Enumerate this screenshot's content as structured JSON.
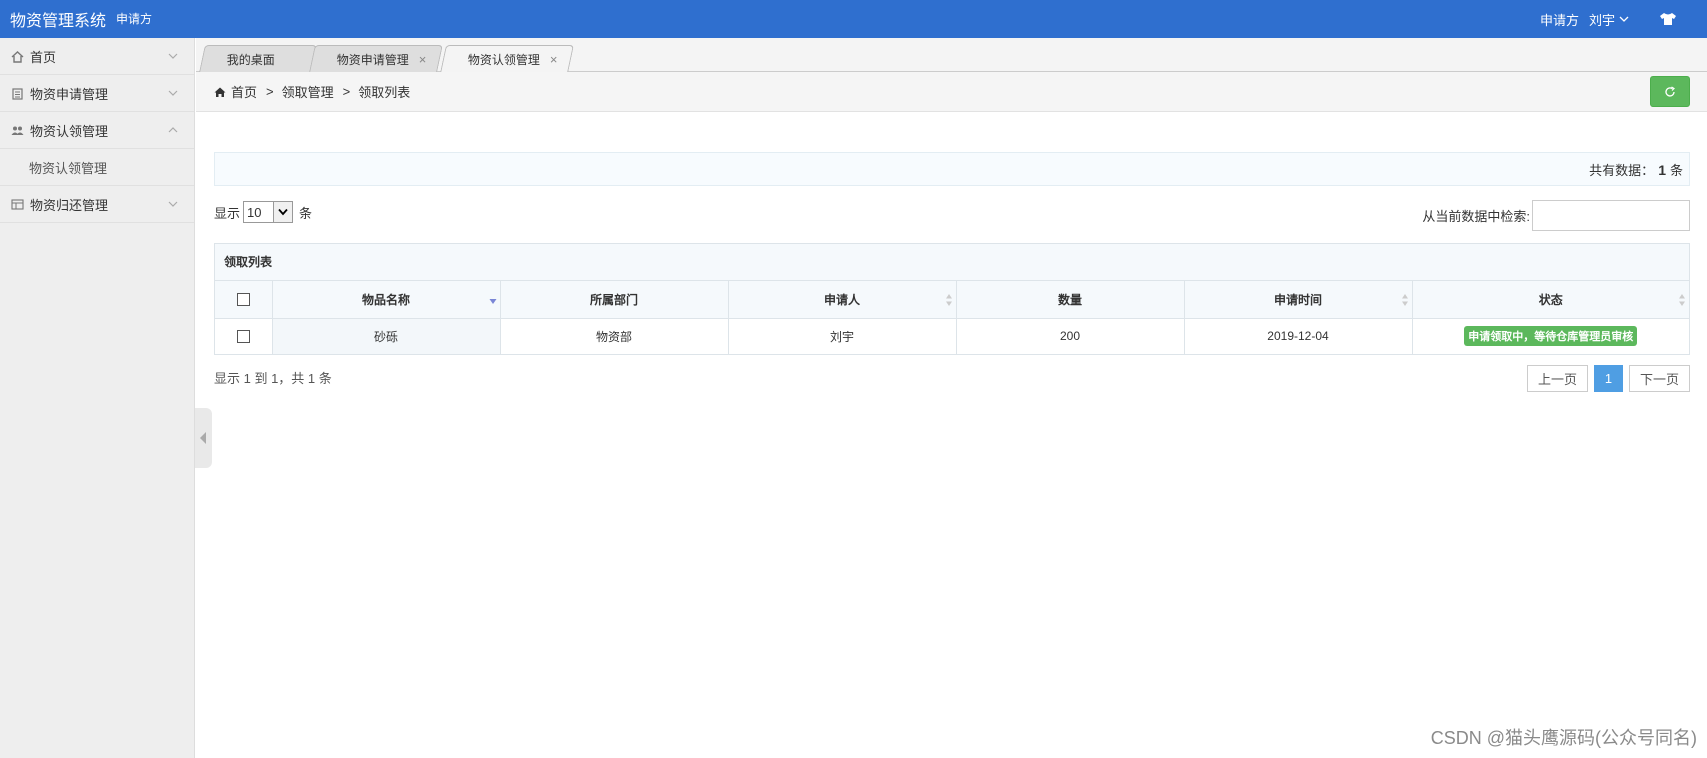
{
  "header": {
    "title": "物资管理系统",
    "role": "申请方",
    "right_role": "申请方",
    "user": "刘宇",
    "colors": {
      "bar": "#2f6fcf"
    }
  },
  "sidebar": {
    "items": [
      {
        "label": "首页",
        "icon": "home-icon",
        "chevron": "down"
      },
      {
        "label": "物资申请管理",
        "icon": "clipboard-icon",
        "chevron": "down"
      },
      {
        "label": "物资认领管理",
        "icon": "users-icon",
        "chevron": "up"
      },
      {
        "label": "物资归还管理",
        "icon": "table-icon",
        "chevron": "down"
      }
    ],
    "sub_item": "物资认领管理"
  },
  "tabs": [
    {
      "label": "我的桌面",
      "closable": false
    },
    {
      "label": "物资申请管理",
      "closable": true
    },
    {
      "label": "物资认领管理",
      "closable": true,
      "active": true
    }
  ],
  "close_glyph": "×",
  "breadcrumb": {
    "home": "首页",
    "sep": ">",
    "level1": "领取管理",
    "level2": "领取列表"
  },
  "summary": {
    "prefix": "共有数据：",
    "count": "1",
    "suffix": "条"
  },
  "length": {
    "prefix": "显示",
    "value": "10",
    "suffix": "条"
  },
  "search": {
    "label": "从当前数据中检索:",
    "value": ""
  },
  "table": {
    "caption": "领取列表",
    "columns": [
      "物品名称",
      "所属部门",
      "申请人",
      "数量",
      "申请时间",
      "状态"
    ],
    "rows": [
      {
        "name": "砂砾",
        "dept": "物资部",
        "applicant": "刘宇",
        "quantity": "200",
        "date": "2019-12-04",
        "status": "申请领取中，等待仓库管理员审核"
      }
    ],
    "status_color": "#5cb85c"
  },
  "footer": {
    "info": "显示 1 到 1，共 1 条",
    "prev": "上一页",
    "page": "1",
    "next": "下一页"
  },
  "watermark": "CSDN @猫头鹰源码(公众号同名)"
}
